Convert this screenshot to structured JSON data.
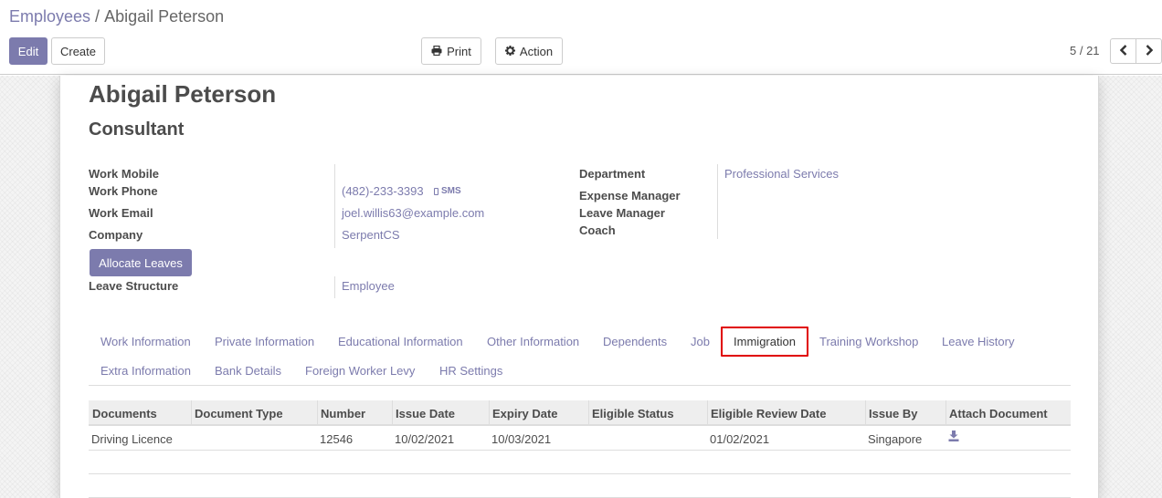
{
  "breadcrumb": {
    "parent": "Employees",
    "separator": "/",
    "current": "Abigail Peterson"
  },
  "buttons": {
    "edit": "Edit",
    "create": "Create",
    "print": "Print",
    "action": "Action"
  },
  "pager": {
    "value": "5 / 21"
  },
  "employee": {
    "name": "Abigail Peterson",
    "job_title": "Consultant",
    "fields_left": [
      {
        "label": "Work Mobile",
        "value": ""
      },
      {
        "label": "Work Phone",
        "value": "(482)-233-3393",
        "action": "SMS"
      },
      {
        "label": "Work Email",
        "value": "joel.willis63@example.com"
      },
      {
        "label": "Company",
        "value": "SerpentCS"
      }
    ],
    "fields_right": [
      {
        "label": "Department",
        "value": "Professional Services"
      },
      {
        "label": "Expense Manager",
        "value": ""
      },
      {
        "label": "Leave Manager",
        "value": ""
      },
      {
        "label": "Coach",
        "value": ""
      }
    ],
    "allocate_leaves": "Allocate Leaves",
    "leave_structure": {
      "label": "Leave Structure",
      "value": "Employee"
    }
  },
  "tabs": [
    "Work Information",
    "Private Information",
    "Educational Information",
    "Other Information",
    "Dependents",
    "Job",
    "Immigration",
    "Training Workshop",
    "Leave History",
    "Extra Information",
    "Bank Details",
    "Foreign Worker Levy",
    "HR Settings"
  ],
  "active_tab": "Immigration",
  "table": {
    "columns": [
      "Documents",
      "Document Type",
      "Number",
      "Issue Date",
      "Expiry Date",
      "Eligible Status",
      "Eligible Review Date",
      "Issue By",
      "Attach Document"
    ],
    "rows": [
      [
        "Driving Licence",
        "",
        "12546",
        "10/02/2021",
        "10/03/2021",
        "",
        "01/02/2021",
        "Singapore",
        "download-icon"
      ]
    ]
  },
  "colors": {
    "accent": "#7c7bad",
    "highlight": "#e00000"
  }
}
